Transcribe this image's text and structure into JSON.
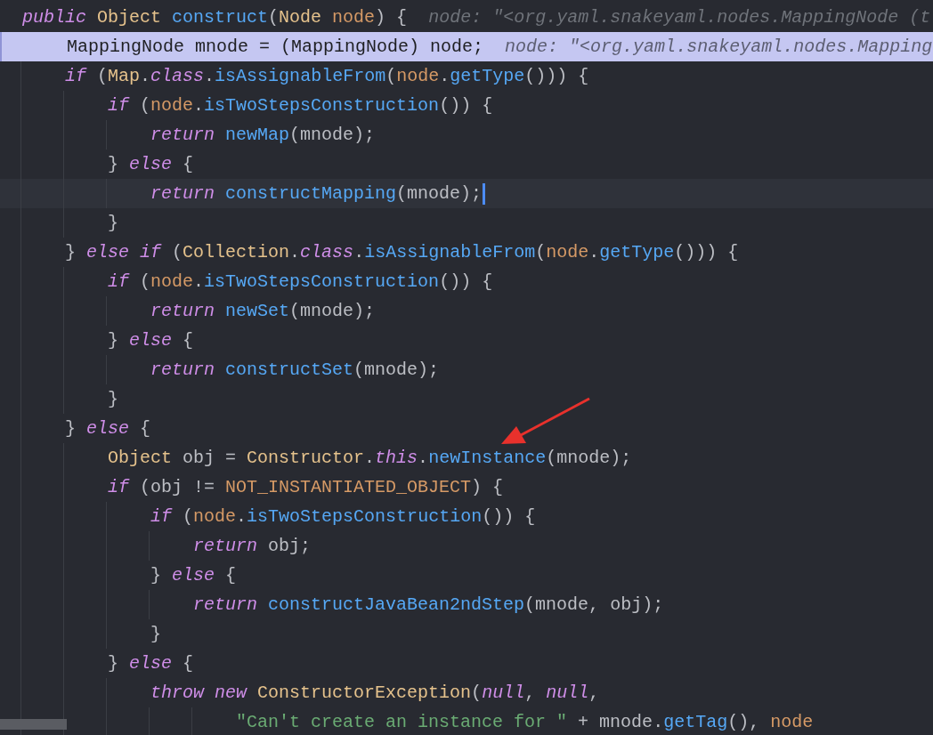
{
  "editor": {
    "lines": [
      {
        "tokens": [
          {
            "kind": "kw",
            "text": "public"
          },
          {
            "kind": "type",
            "text": " Object"
          },
          {
            "kind": "fn",
            "text": " construct"
          },
          {
            "kind": "p",
            "text": "("
          },
          {
            "kind": "type",
            "text": "Node"
          },
          {
            "kind": "param",
            "text": " node"
          },
          {
            "kind": "p",
            "text": ") {"
          }
        ],
        "hint": "node: \"<org.yaml.snakeyaml.nodes.MappingNode (t",
        "highlighted": false,
        "caret": false
      },
      {
        "tokens": [
          {
            "kind": "p",
            "text": "    MappingNode mnode = (MappingNode) node;"
          }
        ],
        "hint": "node: \"<org.yaml.snakeyaml.nodes.Mapping",
        "highlighted": true,
        "caret": false
      },
      {
        "tokens": [
          {
            "kind": "kw",
            "text": "    if"
          },
          {
            "kind": "p",
            "text": " ("
          },
          {
            "kind": "type",
            "text": "Map"
          },
          {
            "kind": "p",
            "text": "."
          },
          {
            "kind": "kw",
            "text": "class"
          },
          {
            "kind": "p",
            "text": "."
          },
          {
            "kind": "fn",
            "text": "isAssignableFrom"
          },
          {
            "kind": "p",
            "text": "("
          },
          {
            "kind": "param",
            "text": "node"
          },
          {
            "kind": "p",
            "text": "."
          },
          {
            "kind": "fn",
            "text": "getType"
          },
          {
            "kind": "p",
            "text": "())) {"
          }
        ],
        "highlighted": false,
        "caret": false
      },
      {
        "tokens": [
          {
            "kind": "kw",
            "text": "        if"
          },
          {
            "kind": "p",
            "text": " ("
          },
          {
            "kind": "param",
            "text": "node"
          },
          {
            "kind": "p",
            "text": "."
          },
          {
            "kind": "fn",
            "text": "isTwoStepsConstruction"
          },
          {
            "kind": "p",
            "text": "()) {"
          }
        ],
        "highlighted": false,
        "caret": false
      },
      {
        "tokens": [
          {
            "kind": "kw",
            "text": "            return"
          },
          {
            "kind": "fn",
            "text": " newMap"
          },
          {
            "kind": "p",
            "text": "(mnode);"
          }
        ],
        "highlighted": false,
        "caret": false
      },
      {
        "tokens": [
          {
            "kind": "p",
            "text": "        } "
          },
          {
            "kind": "kw",
            "text": "else"
          },
          {
            "kind": "p",
            "text": " {"
          }
        ],
        "highlighted": false,
        "caret": false
      },
      {
        "tokens": [
          {
            "kind": "kw",
            "text": "            return"
          },
          {
            "kind": "fn",
            "text": " constructMapping"
          },
          {
            "kind": "p",
            "text": "(mnode);"
          }
        ],
        "highlighted": false,
        "caret": true
      },
      {
        "tokens": [
          {
            "kind": "p",
            "text": "        }"
          }
        ],
        "highlighted": false,
        "caret": false
      },
      {
        "tokens": [
          {
            "kind": "p",
            "text": "    } "
          },
          {
            "kind": "kw",
            "text": "else if"
          },
          {
            "kind": "p",
            "text": " ("
          },
          {
            "kind": "type",
            "text": "Collection"
          },
          {
            "kind": "p",
            "text": "."
          },
          {
            "kind": "kw",
            "text": "class"
          },
          {
            "kind": "p",
            "text": "."
          },
          {
            "kind": "fn",
            "text": "isAssignableFrom"
          },
          {
            "kind": "p",
            "text": "("
          },
          {
            "kind": "param",
            "text": "node"
          },
          {
            "kind": "p",
            "text": "."
          },
          {
            "kind": "fn",
            "text": "getType"
          },
          {
            "kind": "p",
            "text": "())) {"
          }
        ],
        "highlighted": false,
        "caret": false
      },
      {
        "tokens": [
          {
            "kind": "kw",
            "text": "        if"
          },
          {
            "kind": "p",
            "text": " ("
          },
          {
            "kind": "param",
            "text": "node"
          },
          {
            "kind": "p",
            "text": "."
          },
          {
            "kind": "fn",
            "text": "isTwoStepsConstruction"
          },
          {
            "kind": "p",
            "text": "()) {"
          }
        ],
        "highlighted": false,
        "caret": false
      },
      {
        "tokens": [
          {
            "kind": "kw",
            "text": "            return"
          },
          {
            "kind": "fn",
            "text": " newSet"
          },
          {
            "kind": "p",
            "text": "(mnode);"
          }
        ],
        "highlighted": false,
        "caret": false
      },
      {
        "tokens": [
          {
            "kind": "p",
            "text": "        } "
          },
          {
            "kind": "kw",
            "text": "else"
          },
          {
            "kind": "p",
            "text": " {"
          }
        ],
        "highlighted": false,
        "caret": false
      },
      {
        "tokens": [
          {
            "kind": "kw",
            "text": "            return"
          },
          {
            "kind": "fn",
            "text": " constructSet"
          },
          {
            "kind": "p",
            "text": "(mnode);"
          }
        ],
        "highlighted": false,
        "caret": false
      },
      {
        "tokens": [
          {
            "kind": "p",
            "text": "        }"
          }
        ],
        "highlighted": false,
        "caret": false
      },
      {
        "tokens": [
          {
            "kind": "p",
            "text": "    } "
          },
          {
            "kind": "kw",
            "text": "else"
          },
          {
            "kind": "p",
            "text": " {"
          }
        ],
        "highlighted": false,
        "caret": false
      },
      {
        "tokens": [
          {
            "kind": "type",
            "text": "        Object"
          },
          {
            "kind": "p",
            "text": " obj = "
          },
          {
            "kind": "type",
            "text": "Constructor"
          },
          {
            "kind": "p",
            "text": "."
          },
          {
            "kind": "kw",
            "text": "this"
          },
          {
            "kind": "p",
            "text": "."
          },
          {
            "kind": "fn",
            "text": "newInstance"
          },
          {
            "kind": "p",
            "text": "(mnode);"
          }
        ],
        "highlighted": false,
        "caret": false
      },
      {
        "tokens": [
          {
            "kind": "kw",
            "text": "        if"
          },
          {
            "kind": "p",
            "text": " (obj != "
          },
          {
            "kind": "const",
            "text": "NOT_INSTANTIATED_OBJECT"
          },
          {
            "kind": "p",
            "text": ") {"
          }
        ],
        "highlighted": false,
        "caret": false
      },
      {
        "tokens": [
          {
            "kind": "kw",
            "text": "            if"
          },
          {
            "kind": "p",
            "text": " ("
          },
          {
            "kind": "param",
            "text": "node"
          },
          {
            "kind": "p",
            "text": "."
          },
          {
            "kind": "fn",
            "text": "isTwoStepsConstruction"
          },
          {
            "kind": "p",
            "text": "()) {"
          }
        ],
        "highlighted": false,
        "caret": false
      },
      {
        "tokens": [
          {
            "kind": "kw",
            "text": "                return"
          },
          {
            "kind": "p",
            "text": " obj;"
          }
        ],
        "highlighted": false,
        "caret": false
      },
      {
        "tokens": [
          {
            "kind": "p",
            "text": "            } "
          },
          {
            "kind": "kw",
            "text": "else"
          },
          {
            "kind": "p",
            "text": " {"
          }
        ],
        "highlighted": false,
        "caret": false
      },
      {
        "tokens": [
          {
            "kind": "kw",
            "text": "                return"
          },
          {
            "kind": "fn",
            "text": " constructJavaBean2ndStep"
          },
          {
            "kind": "p",
            "text": "(mnode, obj);"
          }
        ],
        "highlighted": false,
        "caret": false
      },
      {
        "tokens": [
          {
            "kind": "p",
            "text": "            }"
          }
        ],
        "highlighted": false,
        "caret": false
      },
      {
        "tokens": [
          {
            "kind": "p",
            "text": "        } "
          },
          {
            "kind": "kw",
            "text": "else"
          },
          {
            "kind": "p",
            "text": " {"
          }
        ],
        "highlighted": false,
        "caret": false
      },
      {
        "tokens": [
          {
            "kind": "kw",
            "text": "            throw new"
          },
          {
            "kind": "type",
            "text": " ConstructorException"
          },
          {
            "kind": "p",
            "text": "("
          },
          {
            "kind": "kw",
            "text": "null"
          },
          {
            "kind": "p",
            "text": ", "
          },
          {
            "kind": "kw",
            "text": "null"
          },
          {
            "kind": "p",
            "text": ","
          }
        ],
        "highlighted": false,
        "caret": false
      },
      {
        "tokens": [
          {
            "kind": "str",
            "text": "                    \"Can't create an instance for \""
          },
          {
            "kind": "p",
            "text": " + mnode."
          },
          {
            "kind": "fn",
            "text": "getTag"
          },
          {
            "kind": "p",
            "text": "(), "
          },
          {
            "kind": "param",
            "text": "node"
          }
        ],
        "highlighted": false,
        "caret": false
      }
    ]
  },
  "annotations": [
    {
      "kind": "arrow"
    }
  ]
}
